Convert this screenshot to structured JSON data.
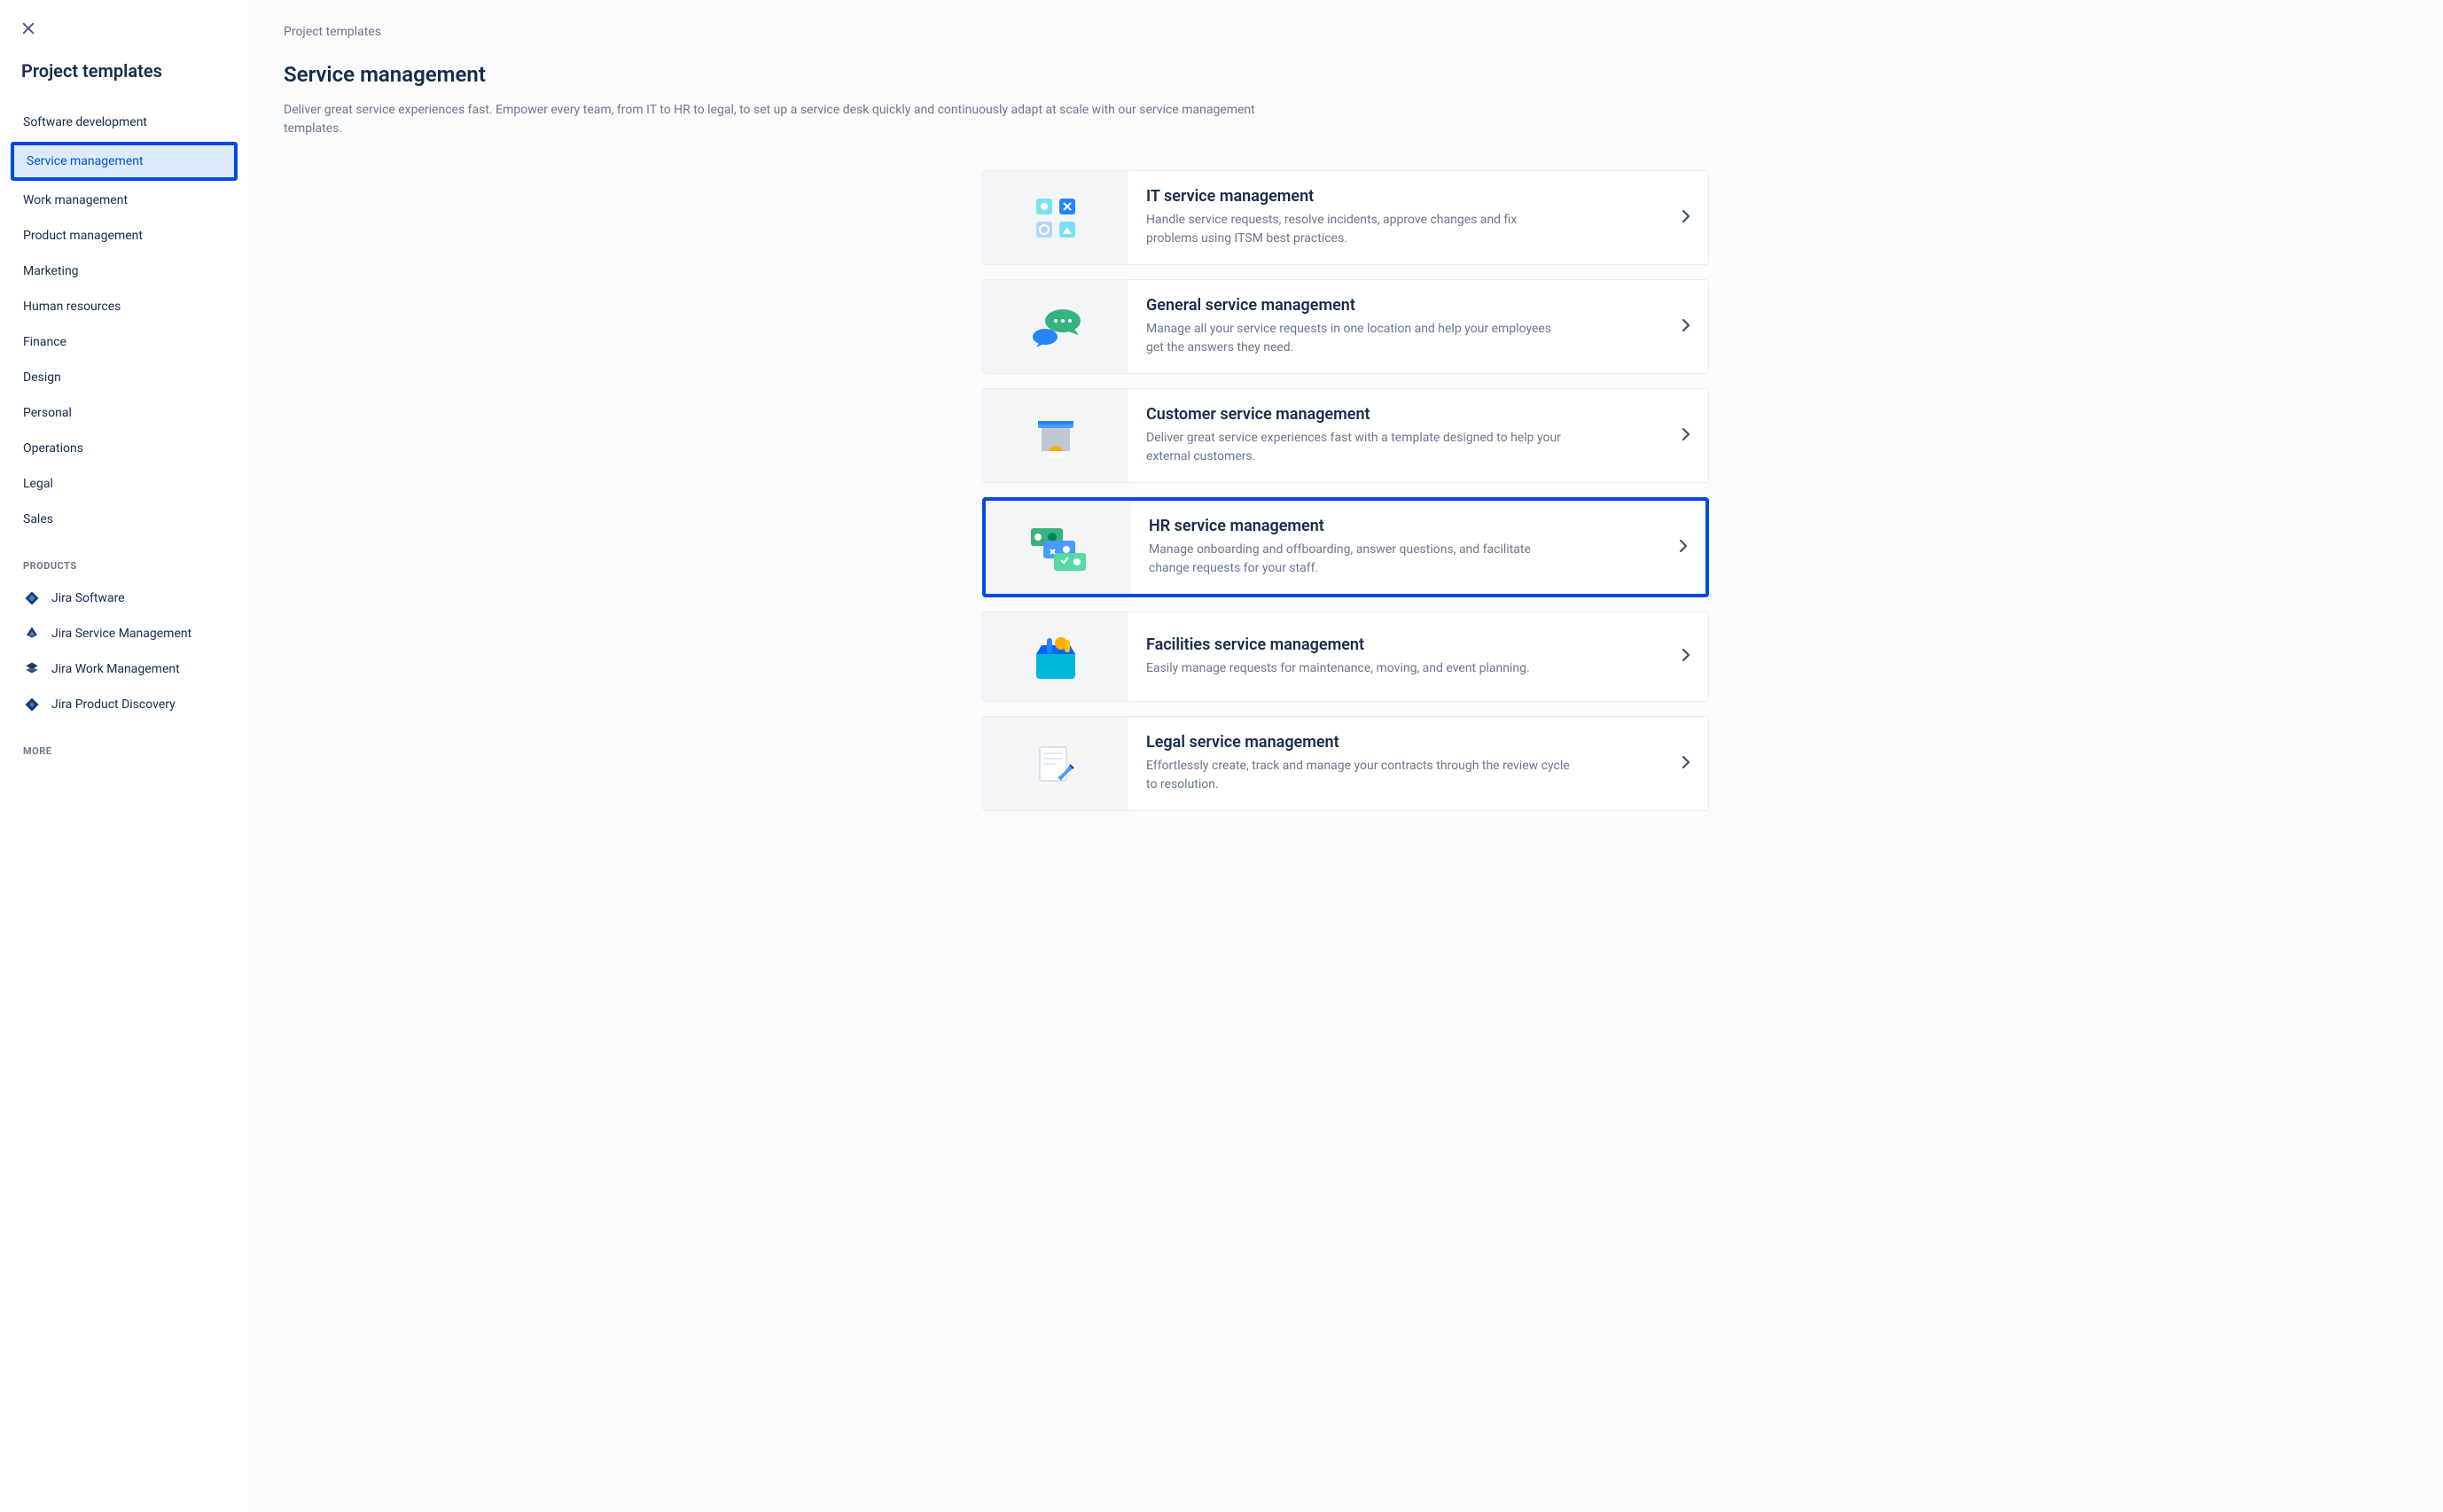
{
  "sidebar": {
    "title": "Project templates",
    "categories": [
      {
        "label": "Software development",
        "active": false
      },
      {
        "label": "Service management",
        "active": true
      },
      {
        "label": "Work management",
        "active": false
      },
      {
        "label": "Product management",
        "active": false
      },
      {
        "label": "Marketing",
        "active": false
      },
      {
        "label": "Human resources",
        "active": false
      },
      {
        "label": "Finance",
        "active": false
      },
      {
        "label": "Design",
        "active": false
      },
      {
        "label": "Personal",
        "active": false
      },
      {
        "label": "Operations",
        "active": false
      },
      {
        "label": "Legal",
        "active": false
      },
      {
        "label": "Sales",
        "active": false
      }
    ],
    "products_label": "PRODUCTS",
    "products": [
      {
        "label": "Jira Software",
        "icon": "jira-software"
      },
      {
        "label": "Jira Service Management",
        "icon": "jira-service"
      },
      {
        "label": "Jira Work Management",
        "icon": "jira-work"
      },
      {
        "label": "Jira Product Discovery",
        "icon": "jira-discovery"
      }
    ],
    "more_label": "MORE"
  },
  "main": {
    "breadcrumb": "Project templates",
    "title": "Service management",
    "description": "Deliver great service experiences fast. Empower every team, from IT to HR to legal, to set up a service desk quickly and continuously adapt at scale with our service management templates.",
    "cards": [
      {
        "title": "IT service management",
        "description": "Handle service requests, resolve incidents, approve changes and fix problems using ITSM best practices.",
        "highlighted": false
      },
      {
        "title": "General service management",
        "description": "Manage all your service requests in one location and help your employees get the answers they need.",
        "highlighted": false
      },
      {
        "title": "Customer service management",
        "description": "Deliver great service experiences fast with a template designed to help your external customers.",
        "highlighted": false
      },
      {
        "title": "HR service management",
        "description": "Manage onboarding and offboarding, answer questions, and facilitate change requests for your staff.",
        "highlighted": true
      },
      {
        "title": "Facilities service management",
        "description": "Easily manage requests for maintenance, moving, and event planning.",
        "highlighted": false
      },
      {
        "title": "Legal service management",
        "description": "Effortlessly create, track and manage your contracts through the review cycle to resolution.",
        "highlighted": false
      }
    ]
  }
}
